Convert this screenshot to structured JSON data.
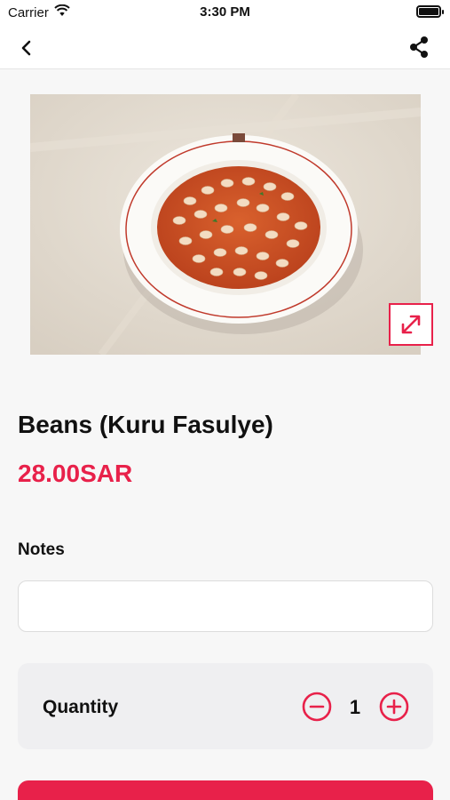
{
  "status_bar": {
    "carrier": "Carrier",
    "time": "3:30 PM"
  },
  "nav": {
    "back_icon": "chevron-left-icon",
    "share_icon": "share-icon"
  },
  "product": {
    "image_alt": "Plate of beans in tomato sauce",
    "title": "Beans (Kuru Fasulye)",
    "price": "28.00SAR",
    "expand_icon": "expand-arrows-icon"
  },
  "notes": {
    "label": "Notes",
    "value": "",
    "placeholder": ""
  },
  "quantity": {
    "label": "Quantity",
    "value": "1",
    "minus_icon": "minus-circle-icon",
    "plus_icon": "plus-circle-icon"
  },
  "colors": {
    "accent": "#e8214a",
    "background": "#f7f7f7",
    "card": "#efeff1"
  }
}
